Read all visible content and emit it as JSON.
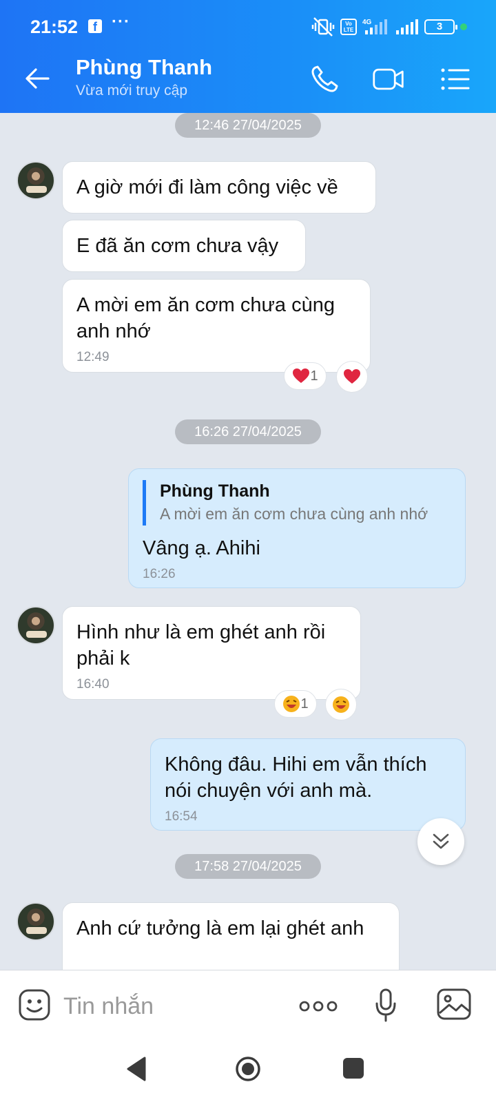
{
  "status_bar": {
    "time": "21:52",
    "fb_icon": "f",
    "dots": "···",
    "lte_label": "Vo LTE",
    "network": "4G",
    "battery": "3"
  },
  "header": {
    "contact_name": "Phùng Thanh",
    "contact_status": "Vừa mới truy cập"
  },
  "chat": {
    "dividers": [
      "12:46 27/04/2025",
      "16:26 27/04/2025",
      "17:58 27/04/2025"
    ],
    "messages": [
      {
        "text": "A giờ mới đi làm công việc về"
      },
      {
        "text": "E đã ăn cơm chưa vậy"
      },
      {
        "text": "A mời em ăn cơm chưa cùng anh nhớ",
        "time": "12:49",
        "reaction_count": "1",
        "reaction": "heart"
      },
      {
        "quote_name": "Phùng Thanh",
        "quote_text": "A mời em ăn cơm chưa cùng anh nhớ",
        "text": "Vâng ạ. Ahihi",
        "time": "16:26"
      },
      {
        "text": "Hình như là em ghét anh rồi phải k",
        "time": "16:40",
        "reaction_count": "1",
        "reaction": "laughing-face"
      },
      {
        "text": "Không đâu. Hihi em vẫn thích nói chuyện với anh mà.",
        "time": "16:54"
      },
      {
        "text": "Anh cứ tưởng là em lại ghét anh"
      }
    ]
  },
  "composer": {
    "placeholder": "Tin nhắn"
  },
  "colors": {
    "header_start": "#1e74f5",
    "header_end": "#19a6fa",
    "chat_bg": "#e2e7ee",
    "mine_bubble": "#d6ecfd",
    "accent": "#1e7af6"
  },
  "icons": [
    "back-arrow-icon",
    "phone-icon",
    "video-icon",
    "menu-list-icon",
    "emoji-icon",
    "more-dots-icon",
    "mic-icon",
    "image-icon",
    "chevron-double-down-icon",
    "heart-icon",
    "laughing-emoji-icon"
  ]
}
